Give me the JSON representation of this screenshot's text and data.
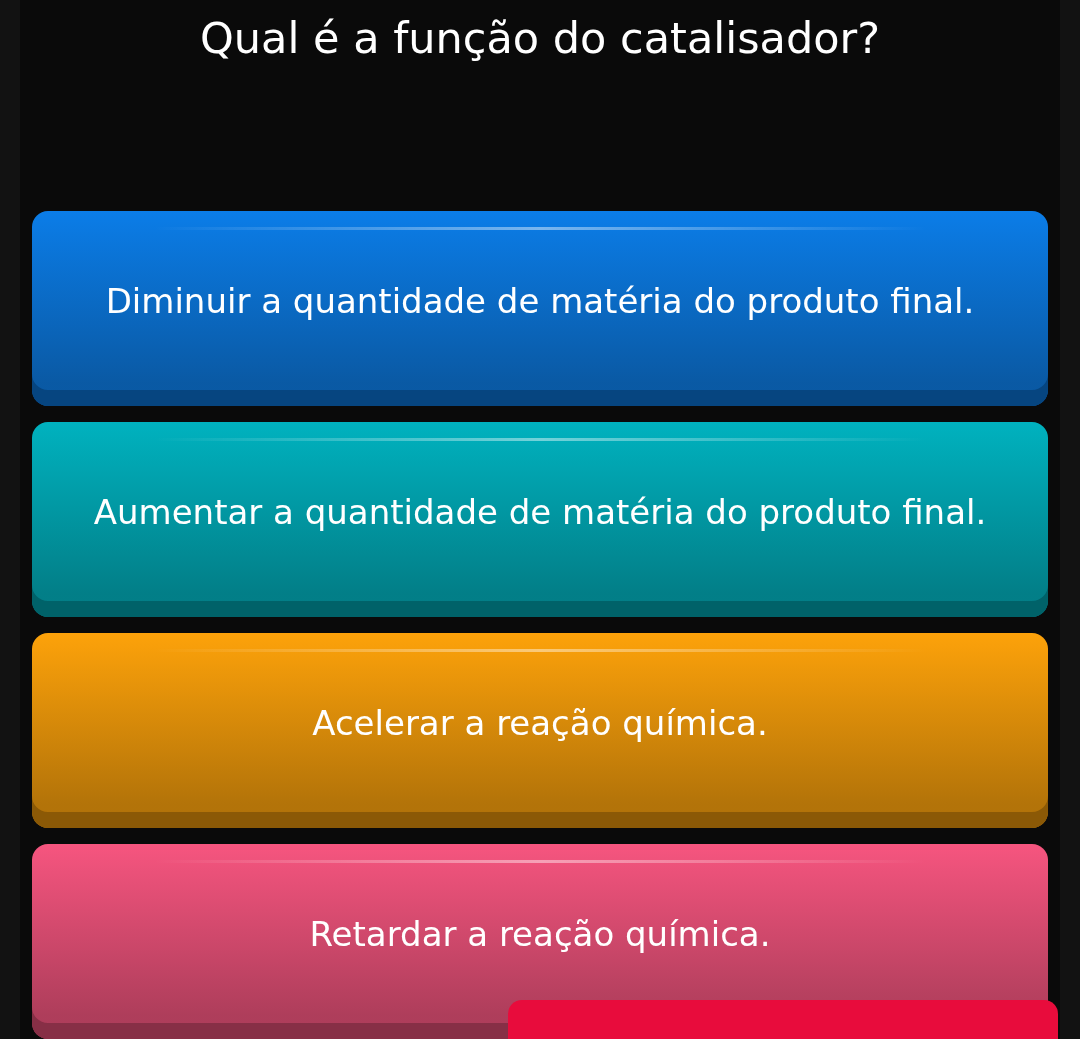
{
  "question": "Qual é a função do catalisador?",
  "options": [
    {
      "label": "Diminuir a quantidade de matéria do produto final.",
      "color": "#0b7de8"
    },
    {
      "label": "Aumentar a quantidade de matéria do produto final.",
      "color": "#00b2bf"
    },
    {
      "label": "Acelerar a reação química.",
      "color": "#fda20a"
    },
    {
      "label": "Retardar a reação química.",
      "color": "#f6557f"
    }
  ]
}
